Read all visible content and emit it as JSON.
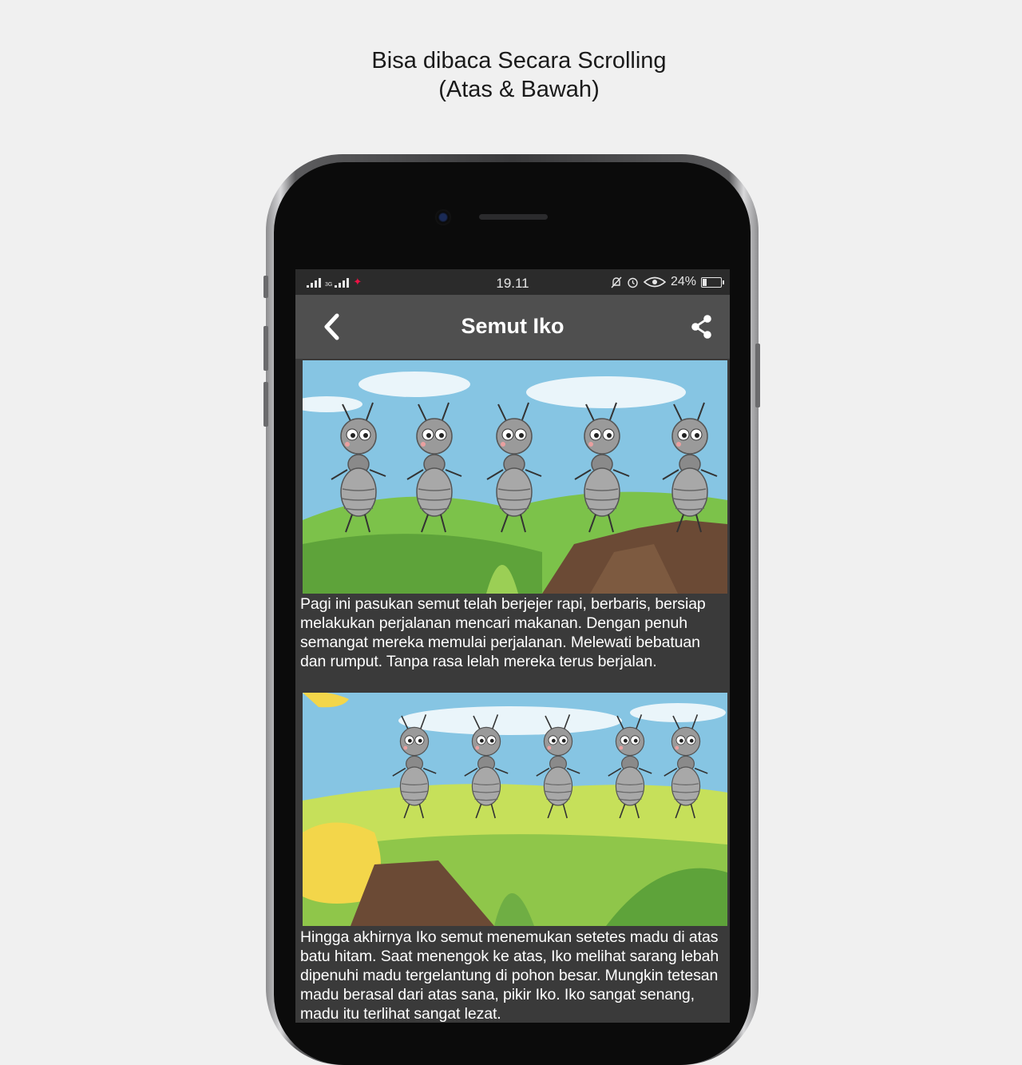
{
  "caption": {
    "line1": "Bisa dibaca Secara Scrolling",
    "line2": "(Atas & Bawah)"
  },
  "status_bar": {
    "network": "3G",
    "time": "19.11",
    "battery": "24%",
    "battery_level": 0.24
  },
  "app_bar": {
    "title": "Semut Iko"
  },
  "stories": [
    {
      "text": "Pagi ini pasukan semut telah berjejer rapi, berbaris, bersiap melakukan perjalanan mencari makanan. Dengan penuh semangat mereka memulai perjalanan. Melewati bebatuan dan rumput. Tanpa rasa lelah mereka terus berjalan."
    },
    {
      "text": "Hingga akhirnya Iko semut menemukan setetes madu di atas batu hitam. Saat menengok ke atas, Iko melihat sarang lebah dipenuhi madu tergelantung di pohon besar. Mungkin tetesan madu berasal dari atas sana, pikir Iko. Iko sangat senang, madu itu terlihat sangat lezat."
    }
  ]
}
